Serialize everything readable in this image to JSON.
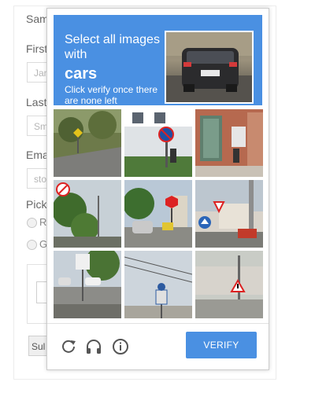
{
  "form": {
    "field_sample": "Sam",
    "first_label": "First",
    "first_placeholder": "Jan",
    "last_label": "Last",
    "last_placeholder": "Sm",
    "email_label": "Ema",
    "email_placeholder": "sto",
    "pick_label": "Pick",
    "radio_1": "R",
    "radio_2": "G",
    "submit": "Sul"
  },
  "captcha": {
    "instruction": "Select all images with",
    "target": "cars",
    "subtext": "Click verify once there are none left",
    "verify_label": "VERIFY",
    "accent_color": "#4a90e2",
    "icons": [
      "refresh-icon",
      "headphones-icon",
      "info-icon"
    ],
    "tiles": [
      "road-sign-curve",
      "no-parking-sign",
      "building-window",
      "no-entry-sign-trees",
      "stop-sign-car",
      "yield-sign-street",
      "street-crossing-car",
      "road-sign-pole",
      "triangle-warning-sign"
    ]
  }
}
